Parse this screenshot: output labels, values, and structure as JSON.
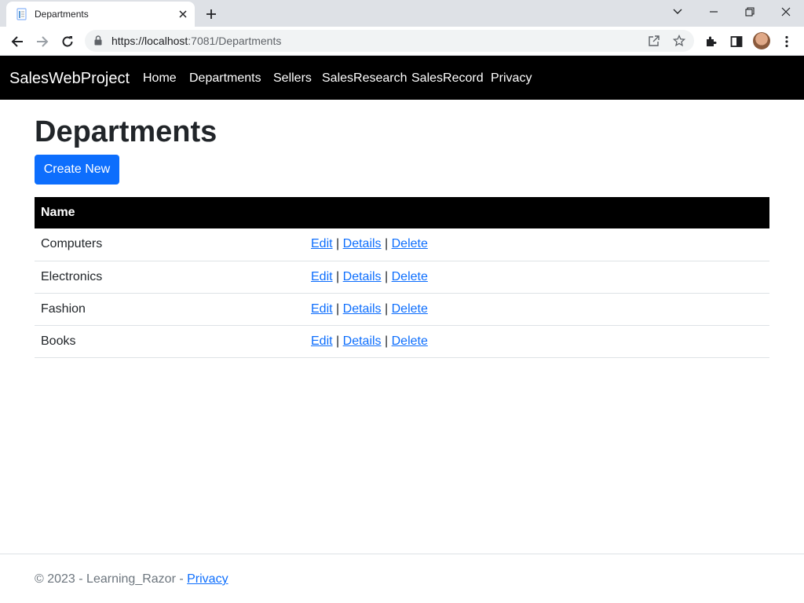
{
  "browser": {
    "tab_title": "Departments",
    "url_host": "https://localhost",
    "url_path": ":7081/Departments"
  },
  "navbar": {
    "brand": "SalesWebProject",
    "links": [
      "Home",
      "Departments",
      "Sellers",
      "SalesResearch",
      "SalesRecord",
      "Privacy"
    ]
  },
  "main": {
    "title": "Departments",
    "create_label": "Create New",
    "table": {
      "header": "Name",
      "rows": [
        "Computers",
        "Electronics",
        "Fashion",
        "Books"
      ],
      "actions": {
        "edit": "Edit",
        "details": "Details",
        "delete": "Delete",
        "separator": "|"
      }
    }
  },
  "footer": {
    "prefix": "© 2023 - Learning_Razor - ",
    "link": "Privacy"
  },
  "colors": {
    "primary": "#0d6efd",
    "navbar_bg": "#000000",
    "table_header_bg": "#000000",
    "footer_text": "#6c757d"
  }
}
